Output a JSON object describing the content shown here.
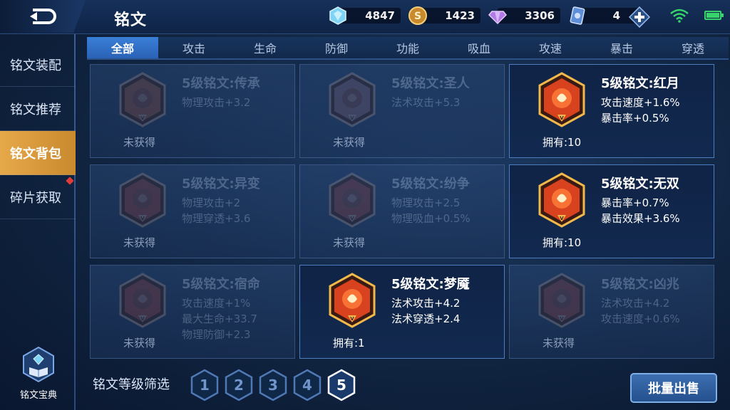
{
  "header": {
    "title": "铭文",
    "currencies": [
      {
        "icon": "diamond-crystal-icon",
        "value": "4847"
      },
      {
        "icon": "gold-coin-icon",
        "value": "1423"
      },
      {
        "icon": "purple-gem-icon",
        "value": "3306"
      },
      {
        "icon": "ticket-card-icon",
        "value": "4"
      }
    ]
  },
  "sidebar": {
    "items": [
      {
        "label": "铭文装配",
        "active": false
      },
      {
        "label": "铭文推荐",
        "active": false
      },
      {
        "label": "铭文背包",
        "active": true
      },
      {
        "label": "碎片获取",
        "active": false
      }
    ],
    "codex_label": "铭文宝典"
  },
  "tabs": [
    "全部",
    "攻击",
    "生命",
    "防御",
    "功能",
    "吸血",
    "攻速",
    "暴击",
    "穿透"
  ],
  "active_tab": 0,
  "cards": [
    {
      "name": "5级铭文:传承",
      "stats": [
        "物理攻击+3.2"
      ],
      "owned": false,
      "status": "未获得",
      "color": "#8a4a3a"
    },
    {
      "name": "5级铭文:圣人",
      "stats": [
        "法术攻击+5.3"
      ],
      "owned": false,
      "status": "未获得",
      "color": "#7a5a6a"
    },
    {
      "name": "5级铭文:红月",
      "stats": [
        "攻击速度+1.6%",
        "暴击率+0.5%"
      ],
      "owned": true,
      "status": "拥有:10",
      "color": "#d8421e"
    },
    {
      "name": "5级铭文:异变",
      "stats": [
        "物理攻击+2",
        "物理穿透+3.6"
      ],
      "owned": false,
      "status": "未获得",
      "color": "#8a3a3a"
    },
    {
      "name": "5级铭文:纷争",
      "stats": [
        "物理攻击+2.5",
        "物理吸血+0.5%"
      ],
      "owned": false,
      "status": "未获得",
      "color": "#8a3a3a"
    },
    {
      "name": "5级铭文:无双",
      "stats": [
        "暴击率+0.7%",
        "暴击效果+3.6%"
      ],
      "owned": true,
      "status": "拥有:10",
      "color": "#d8421e"
    },
    {
      "name": "5级铭文:宿命",
      "stats": [
        "攻击速度+1%",
        "最大生命+33.7",
        "物理防御+2.3"
      ],
      "owned": false,
      "status": "未获得",
      "color": "#8a3a3a"
    },
    {
      "name": "5级铭文:梦魇",
      "stats": [
        "法术攻击+4.2",
        "法术穿透+2.4"
      ],
      "owned": true,
      "status": "拥有:1",
      "color": "#d8421e"
    },
    {
      "name": "5级铭文:凶兆",
      "stats": [
        "法术攻击+4.2",
        "攻击速度+0.6%"
      ],
      "owned": false,
      "status": "未获得",
      "color": "#8a3a3a"
    }
  ],
  "filter": {
    "label": "铭文等级筛选",
    "levels": [
      "1",
      "2",
      "3",
      "4",
      "5"
    ],
    "active_level": "5"
  },
  "actions": {
    "bulk_sell": "批量出售"
  }
}
